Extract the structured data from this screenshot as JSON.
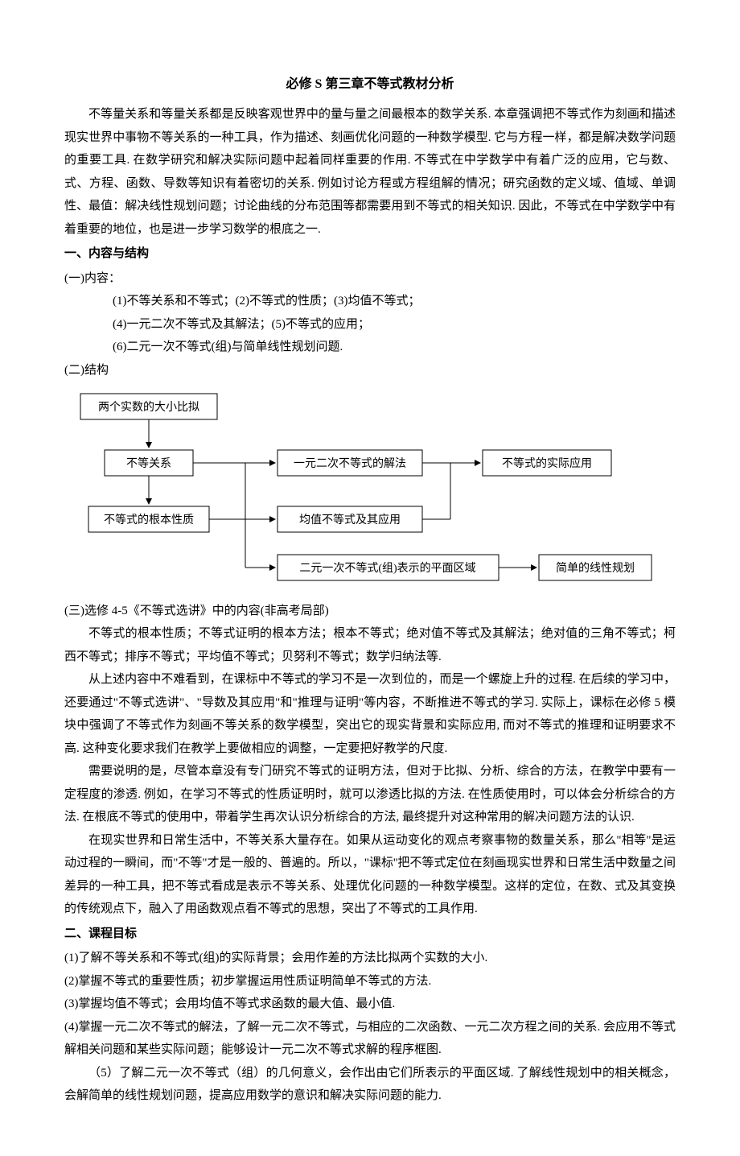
{
  "title": "必修 S 第三章不等式教材分析",
  "intro": "不等量关系和等量关系都是反映客观世界中的量与量之间最根本的数学关系. 本章强调把不等式作为刻画和描述现实世界中事物不等关系的一种工具，作为描述、刻画优化问题的一种数学模型. 它与方程一样，都是解决数学问题的重要工具. 在数学研究和解决实际问题中起着同样重要的作用. 不等式在中学数学中有着广泛的应用，它与数、式、方程、函数、导数等知识有着密切的关系. 例如讨论方程或方程组解的情况；研究函数的定义域、值域、单调性、最值：解决线性规划问题；讨论曲线的分布范围等都需要用到不等式的相关知识. 因此，不等式在中学数学中有着重要的地位，也是进一步学习数学的根底之一.",
  "s1": {
    "heading": "一、内容与结构",
    "sub1_label": "(一)内容：",
    "item1": "(1)不等关系和不等式；(2)不等式的性质；(3)均值不等式；",
    "item2": "(4)一元二次不等式及其解法；(5)不等式的应用；",
    "item3": "(6)二元一次不等式(组)与简单线性规划问题.",
    "sub2_label": "(二)结构"
  },
  "diagram": {
    "box1": "两个实数的大小比拟",
    "box2": "不等关系",
    "box3": "不等式的根本性质",
    "box4": "一元二次不等式的解法",
    "box5": "不等式的实际应用",
    "box6": "均值不等式及其应用",
    "box7": "二元一次不等式(组)表示的平面区域",
    "box8": "简单的线性规划"
  },
  "s1c": {
    "sub3_label": "(三)选修 4-5《不等式选讲》中的内容(非高考局部)",
    "p1": "不等式的根本性质；不等式证明的根本方法；根本不等式；绝对值不等式及其解法；绝对值的三角不等式；柯西不等式；排序不等式；平均值不等式；贝努利不等式；数学归纳法等.",
    "p2": "从上述内容中不难看到，在课标中不等式的学习不是一次到位的，而是一个螺旋上升的过程. 在后续的学习中，还要通过\"不等式选讲\"、\"导数及其应用\"和\"推理与证明\"等内容，不断推进不等式的学习. 实际上，课标在必修 5 模块中强调了不等式作为刻画不等关系的数学模型，突出它的现实背景和实际应用, 而对不等式的推理和证明要求不高. 这种变化要求我们在教学上要做相应的调整，一定要把好教学的尺度.",
    "p3": "需要说明的是，尽管本章没有专门研究不等式的证明方法，但对于比拟、分析、综合的方法，在教学中要有一定程度的渗透. 例如，在学习不等式的性质证明时，就可以渗透比拟的方法. 在性质使用时，可以体会分析综合的方法. 在根底不等式的使用中，带着学生再次认识分析综合的方法, 最终提升对这种常用的解决问题方法的认识.",
    "p4": "在现实世界和日常生活中，不等关系大量存在。如果从运动变化的观点考察事物的数量关系，那么\"相等\"是运动过程的一瞬间，而\"不等\"才是一般的、普遍的。所以，\"课标''把不等式定位在刻画现实世界和日常生活中数量之间差异的一种工具，把不等式看成是表示不等关系、处理优化问题的一种数学模型。这样的定位，在数、式及其变换的传统观点下，融入了用函数观点看不等式的思想，突出了不等式的工具作用."
  },
  "s2": {
    "heading": "二、课程目标",
    "g1": "(1)了解不等关系和不等式(组)的实际背景；会用作差的方法比拟两个实数的大小.",
    "g2": "(2)掌握不等式的重要性质；初步掌握运用性质证明简单不等式的方法.",
    "g3": "(3)掌握均值不等式；会用均值不等式求函数的最大值、最小值.",
    "g4": "(4)掌握一元二次不等式的解法，了解一元二次不等式，与相应的二次函数、一元二次方程之间的关系. 会应用不等式解相关问题和某些实际问题；能够设计一元二次不等式求解的程序框图.",
    "g5": "（5）了解二元一次不等式（组）的几何意义，会作出由它们所表示的平面区域. 了解线性规划中的相关概念，会解简单的线性规划问题，提高应用数学的意识和解决实际问题的能力."
  }
}
